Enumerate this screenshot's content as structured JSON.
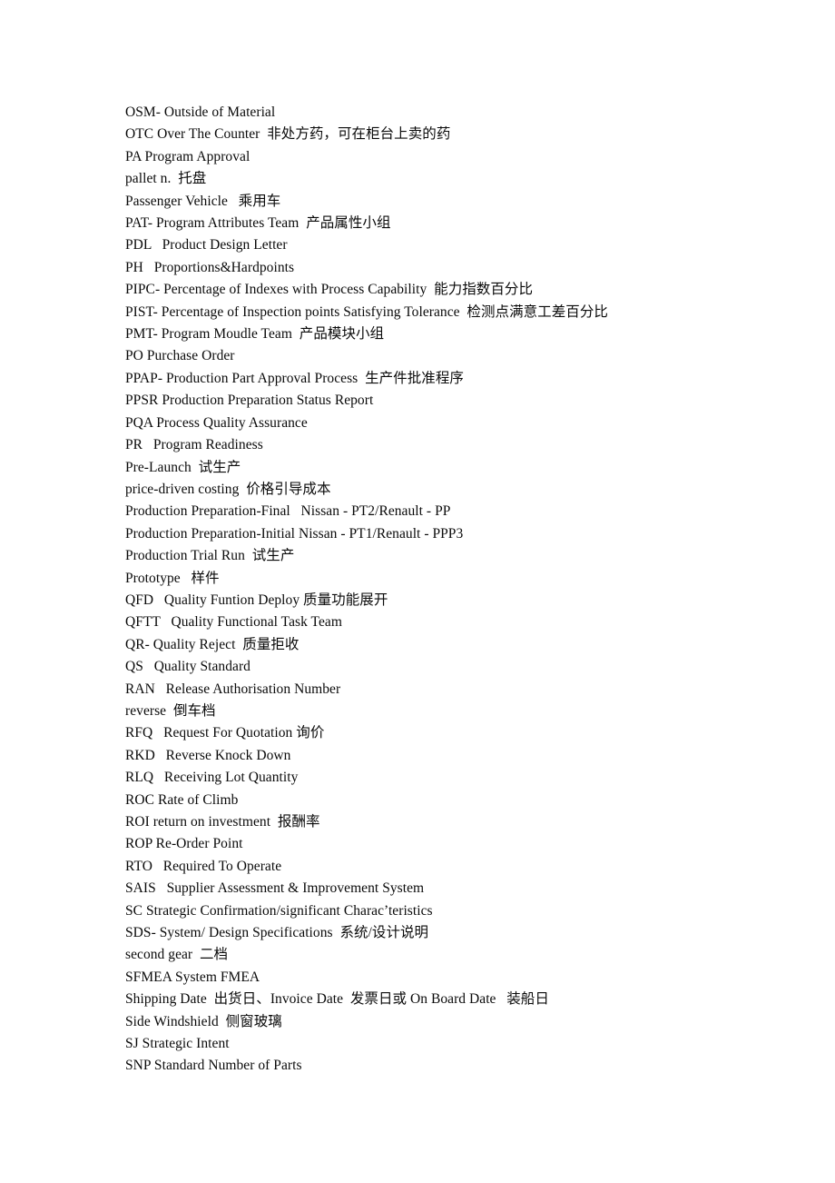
{
  "document": {
    "type": "glossary",
    "background_color": "#ffffff",
    "text_color": "#0a0a0a",
    "lines": [
      "OSM- Outside of Material",
      "OTC Over The Counter  非处方药，可在柜台上卖的药",
      "PA Program Approval",
      "pallet n.  托盘",
      "Passenger Vehicle   乘用车",
      "PAT- Program Attributes Team  产品属性小组",
      "PDL   Product Design Letter",
      "PH   Proportions&Hardpoints",
      "PIPC- Percentage of Indexes with Process Capability  能力指数百分比",
      "PIST- Percentage of Inspection points Satisfying Tolerance  检测点满意工差百分比",
      "PMT- Program Moudle Team  产品模块小组",
      "PO Purchase Order",
      "PPAP- Production Part Approval Process  生产件批准程序",
      "PPSR Production Preparation Status Report",
      "PQA Process Quality Assurance",
      "PR   Program Readiness",
      "Pre-Launch  试生产",
      "price-driven costing  价格引导成本",
      "Production Preparation-Final   Nissan - PT2/Renault - PP",
      "Production Preparation-Initial Nissan - PT1/Renault - PPP3",
      "Production Trial Run  试生产",
      "Prototype   样件",
      "QFD   Quality Funtion Deploy 质量功能展开",
      "QFTT   Quality Functional Task Team",
      "QR- Quality Reject  质量拒收",
      "QS   Quality Standard",
      "RAN   Release Authorisation Number",
      "reverse  倒车档",
      "RFQ   Request For Quotation 询价",
      "RKD   Reverse Knock Down",
      "RLQ   Receiving Lot Quantity",
      "ROC Rate of Climb",
      "ROI return on investment  报酬率",
      "ROP Re-Order Point",
      "RTO   Required To Operate",
      "SAIS   Supplier Assessment & Improvement System",
      "SC Strategic Confirmation/significant Charac’teristics",
      "SDS- System/ Design Specifications  系统/设计说明",
      "second gear  二档",
      "SFMEA System FMEA",
      "Shipping Date  出货日、Invoice Date  发票日或 On Board Date   装船日",
      "Side Windshield  侧窗玻璃",
      "SJ Strategic Intent",
      "SNP Standard Number of Parts"
    ]
  }
}
